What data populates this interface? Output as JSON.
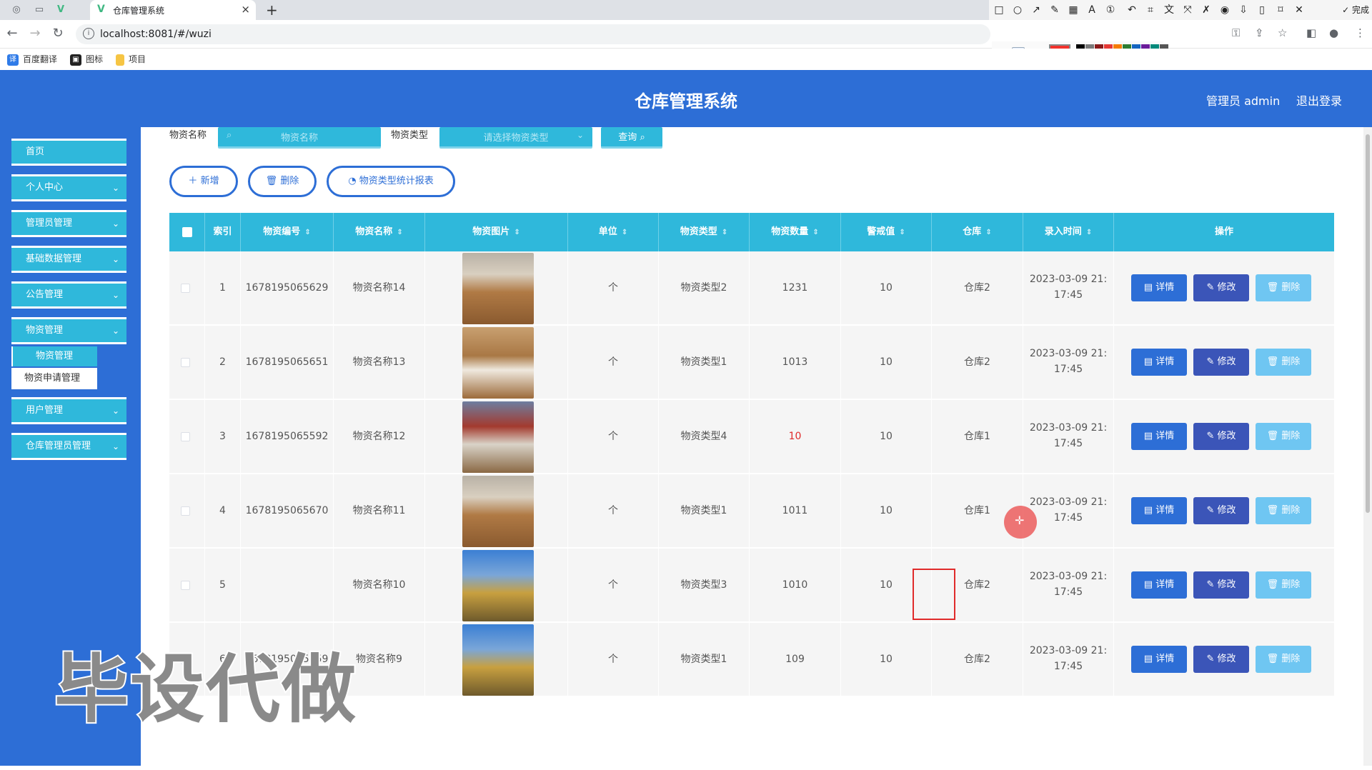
{
  "browser": {
    "tab_title": "仓库管理系统",
    "url": "localhost:8081/#/wuzi",
    "annotation_done": "完成",
    "bookmarks": [
      "百度翻译",
      "图标",
      "项目"
    ]
  },
  "header": {
    "title": "仓库管理系统",
    "user": "管理员 admin",
    "logout": "退出登录"
  },
  "sidebar": {
    "items": [
      {
        "label": "首页",
        "has_children": false
      },
      {
        "label": "个人中心",
        "has_children": true
      },
      {
        "label": "管理员管理",
        "has_children": true
      },
      {
        "label": "基础数据管理",
        "has_children": true
      },
      {
        "label": "公告管理",
        "has_children": true
      },
      {
        "label": "物资管理",
        "has_children": true
      },
      {
        "label": "用户管理",
        "has_children": true
      },
      {
        "label": "仓库管理员管理",
        "has_children": true
      }
    ],
    "subitems": [
      "物资管理",
      "物资申请管理"
    ]
  },
  "search": {
    "name_label": "物资名称",
    "name_placeholder": "物资名称",
    "type_label": "物资类型",
    "type_placeholder": "请选择物资类型",
    "query_label": "查询"
  },
  "actions": {
    "add": "新增",
    "delete": "删除",
    "report": "物资类型统计报表"
  },
  "table": {
    "columns": [
      "索引",
      "物资编号",
      "物资名称",
      "物资图片",
      "单位",
      "物资类型",
      "物资数量",
      "警戒值",
      "仓库",
      "录入时间",
      "操作"
    ],
    "rows": [
      {
        "index": "1",
        "code": "1678195065629",
        "name": "物资名称14",
        "unit": "个",
        "type": "物资类型2",
        "qty": "1231",
        "warn": "10",
        "warehouse": "仓库2",
        "time1": "2023-03-09 21:",
        "time2": "17:45"
      },
      {
        "index": "2",
        "code": "1678195065651",
        "name": "物资名称13",
        "unit": "个",
        "type": "物资类型1",
        "qty": "1013",
        "warn": "10",
        "warehouse": "仓库2",
        "time1": "2023-03-09 21:",
        "time2": "17:45"
      },
      {
        "index": "3",
        "code": "1678195065592",
        "name": "物资名称12",
        "unit": "个",
        "type": "物资类型4",
        "qty": "10",
        "warn": "10",
        "warehouse": "仓库1",
        "time1": "2023-03-09 21:",
        "time2": "17:45"
      },
      {
        "index": "4",
        "code": "1678195065670",
        "name": "物资名称11",
        "unit": "个",
        "type": "物资类型1",
        "qty": "1011",
        "warn": "10",
        "warehouse": "仓库1",
        "time1": "2023-03-09 21:",
        "time2": "17:45"
      },
      {
        "index": "5",
        "code": "",
        "name": "物资名称10",
        "unit": "个",
        "type": "物资类型3",
        "qty": "1010",
        "warn": "10",
        "warehouse": "仓库2",
        "time1": "2023-03-09 21:",
        "time2": "17:45"
      },
      {
        "index": "6",
        "code": "1678195065659",
        "name": "物资名称9",
        "unit": "个",
        "type": "物资类型1",
        "qty": "109",
        "warn": "10",
        "warehouse": "仓库2",
        "time1": "2023-03-09 21:",
        "time2": "17:45"
      }
    ],
    "btn_detail": "详情",
    "btn_edit": "修改",
    "btn_delete": "删除"
  },
  "watermark": "毕设代做",
  "colors": {
    "primary": "#2d6ed6",
    "accent": "#2fb8db",
    "edit": "#3b55b8",
    "delete": "#6fc6f2",
    "annotation": "#e02b2b"
  }
}
